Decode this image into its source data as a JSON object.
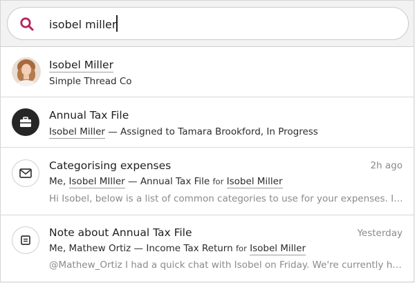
{
  "search": {
    "value": "isobel miller",
    "icon": "search-icon",
    "icon_color": "#b8235a"
  },
  "results": [
    {
      "type": "contact",
      "title": "Isobel Miller",
      "subtitle": "Simple Thread Co",
      "icon": "avatar"
    },
    {
      "type": "file",
      "title": "Annual Tax File",
      "sub_name": "Isobel Miller",
      "sub_rest": " — Assigned to Tamara Brookford, In Progress",
      "icon": "briefcase-icon"
    },
    {
      "type": "message",
      "title": "Categorising expenses",
      "time": "2h ago",
      "sub_prefix": "Me, ",
      "sub_name": "Isobel MIller",
      "sub_mid": " — Annual Tax File ",
      "for_label": "for",
      "sub_for_name": "Isobel Miller",
      "preview_pre": "Hi ",
      "preview_name": "Isobel",
      "preview_rest": ", below is a list of common categories to use for your expenses. If you d...",
      "icon": "envelope-icon"
    },
    {
      "type": "note",
      "title": "Note about Annual Tax File",
      "time": "Yesterday",
      "sub_prefix": "Me, Mathew Ortiz",
      "sub_mid": " — Income Tax Return ",
      "for_label": "for",
      "sub_for_name": "Isobel Miller",
      "preview_pre": "@Mathew_Ortiz I had a quick chat with ",
      "preview_name": "Isobel",
      "preview_rest": " on Friday. We're currently handlin...",
      "icon": "note-icon"
    }
  ]
}
